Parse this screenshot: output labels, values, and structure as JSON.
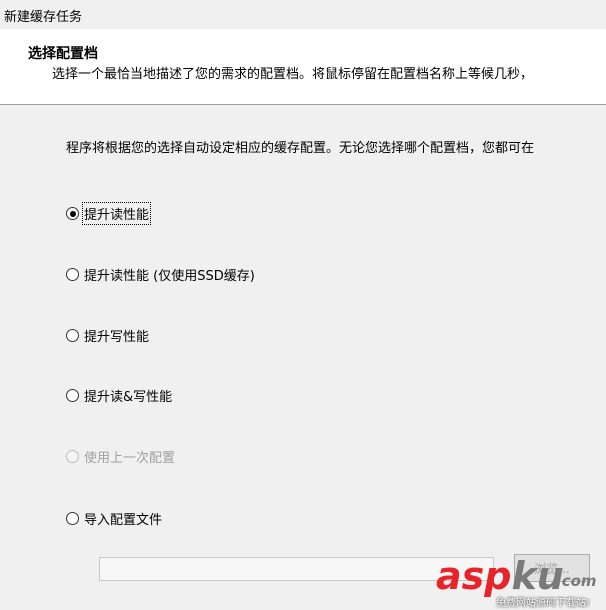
{
  "window": {
    "title": "新建缓存任务"
  },
  "header": {
    "title": "选择配置档",
    "description": "选择一个最恰当地描述了您的需求的配置档。将鼠标停留在配置档名称上等候几秒，"
  },
  "intro_text": "程序将根据您的选择自动设定相应的缓存配置。无论您选择哪个配置档，您都可在",
  "options": [
    {
      "label": "提升读性能",
      "checked": true,
      "disabled": false
    },
    {
      "label": "提升读性能 (仅使用SSD缓存)",
      "checked": false,
      "disabled": false
    },
    {
      "label": "提升写性能",
      "checked": false,
      "disabled": false
    },
    {
      "label": "提升读&写性能",
      "checked": false,
      "disabled": false
    },
    {
      "label": "使用上一次配置",
      "checked": false,
      "disabled": true
    },
    {
      "label": "导入配置文件",
      "checked": false,
      "disabled": false
    }
  ],
  "import": {
    "path_value": "",
    "browse_label": "浏览..."
  },
  "watermark": {
    "main_a": "asp",
    "main_b": "ku",
    "suffix": ".com",
    "sub": "免费网站源码下载站!"
  }
}
